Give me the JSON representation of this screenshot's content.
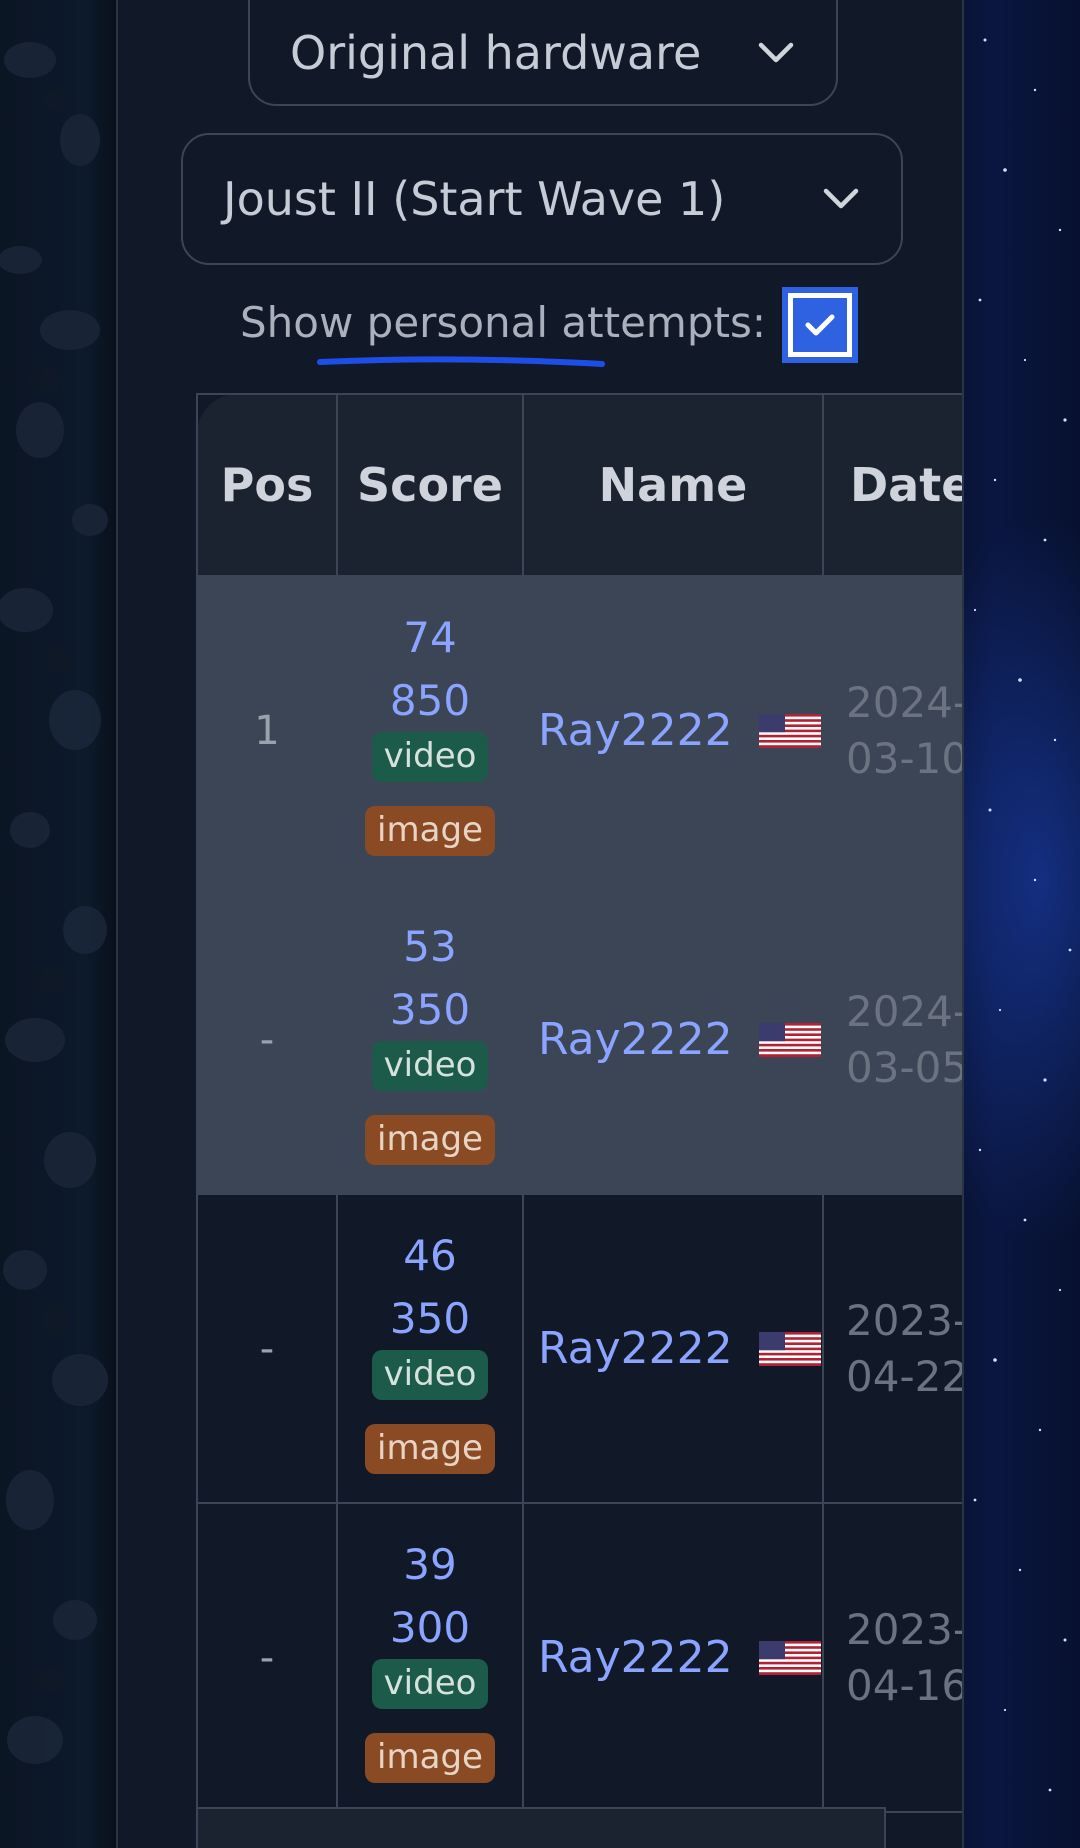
{
  "filters": {
    "hardware": "Original hardware",
    "game": "Joust II (Start Wave 1)",
    "personal_label": "Show personal attempts:",
    "personal_checked": true
  },
  "table": {
    "headers": [
      "Pos",
      "Score",
      "Name",
      "Date"
    ],
    "rows": [
      {
        "pos": "1",
        "score_line1": "74",
        "score_line2": "850",
        "video": "video",
        "image": "image",
        "name": "Ray2222",
        "date_line1": "2024-",
        "date_line2": "03-10"
      },
      {
        "pos": "-",
        "score_line1": "53",
        "score_line2": "350",
        "video": "video",
        "image": "image",
        "name": "Ray2222",
        "date_line1": "2024-",
        "date_line2": "03-05"
      },
      {
        "pos": "-",
        "score_line1": "46",
        "score_line2": "350",
        "video": "video",
        "image": "image",
        "name": "Ray2222",
        "date_line1": "2023-",
        "date_line2": "04-22"
      },
      {
        "pos": "-",
        "score_line1": "39",
        "score_line2": "300",
        "video": "video",
        "image": "image",
        "name": "Ray2222",
        "date_line1": "2023-",
        "date_line2": "04-16"
      }
    ]
  },
  "icons": {
    "select_chevron": "chevron-down-icon",
    "checkbox_check": "check-icon",
    "country_flag": "us-flag-icon"
  },
  "colors": {
    "link": "#8aa4ff",
    "video_badge": "#1c5a4a",
    "image_badge": "#8a4a24",
    "checkbox": "#2f62e0",
    "highlight_row": "#3c4556"
  }
}
